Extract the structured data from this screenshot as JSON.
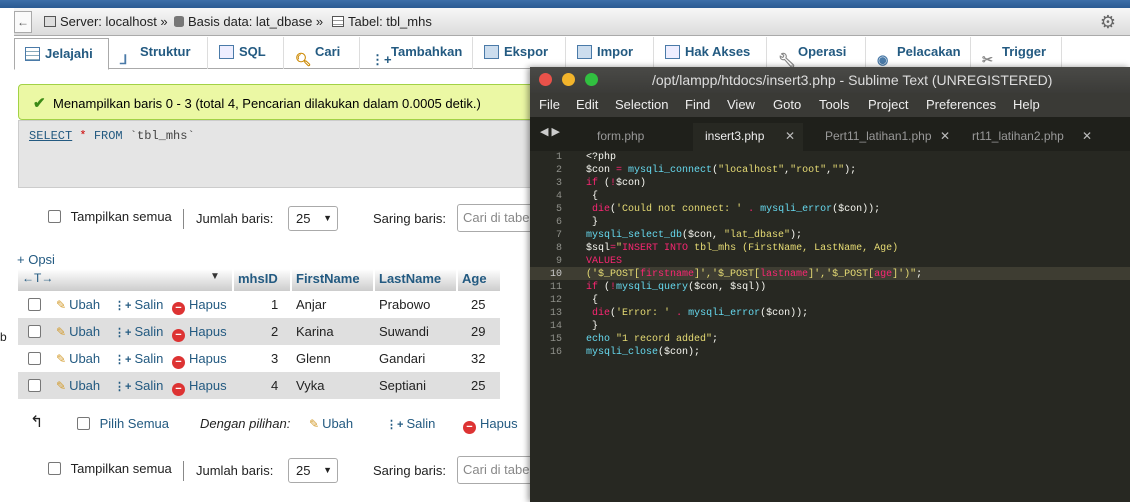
{
  "pma": {
    "breadcrumb": {
      "back": "←",
      "server": "Server: localhost »",
      "database": "Basis data: lat_dbase »",
      "table": "Tabel: tbl_mhs"
    },
    "tabs": [
      {
        "label": "Jelajahi",
        "icon": "browse-icon"
      },
      {
        "label": "Struktur",
        "icon": "structure-icon"
      },
      {
        "label": "SQL",
        "icon": "sql-icon"
      },
      {
        "label": "Cari",
        "icon": "search-icon"
      },
      {
        "label": "Tambahkan",
        "icon": "insert-icon"
      },
      {
        "label": "Ekspor",
        "icon": "export-icon"
      },
      {
        "label": "Impor",
        "icon": "import-icon"
      },
      {
        "label": "Hak Akses",
        "icon": "privileges-icon"
      },
      {
        "label": "Operasi",
        "icon": "operations-icon"
      },
      {
        "label": "Pelacakan",
        "icon": "tracking-icon"
      },
      {
        "label": "Trigger",
        "icon": "trigger-icon"
      }
    ],
    "success_message": "Menampilkan baris 0 - 3 (total 4, Pencarian dilakukan dalam 0.0005 detik.)",
    "sql": {
      "select": "SELECT",
      "star": "*",
      "from": "FROM",
      "table": "`tbl_mhs`"
    },
    "controls_top": {
      "show_all": "Tampilkan semua",
      "rows_label": "Jumlah baris:",
      "rows_value": "25",
      "filter_label": "Saring baris:",
      "filter_placeholder": "Cari di tabe"
    },
    "options_link": "+ Opsi",
    "columns": [
      "mhsID",
      "FirstName",
      "LastName",
      "Age"
    ],
    "actions": {
      "edit": "Ubah",
      "copy": "Salin",
      "delete": "Hapus"
    },
    "rows": [
      {
        "id": "1",
        "first": "Anjar",
        "last": "Prabowo",
        "age": "25"
      },
      {
        "id": "2",
        "first": "Karina",
        "last": "Suwandi",
        "age": "29"
      },
      {
        "id": "3",
        "first": "Glenn",
        "last": "Gandari",
        "age": "32"
      },
      {
        "id": "4",
        "first": "Vyka",
        "last": "Septiani",
        "age": "25"
      }
    ],
    "bulk": {
      "select_all": "Pilih Semua",
      "with_selected": "Dengan pilihan:",
      "edit": "Ubah",
      "copy": "Salin",
      "delete": "Hapus"
    },
    "controls_bottom": {
      "show_all": "Tampilkan semua",
      "rows_label": "Jumlah baris:",
      "rows_value": "25",
      "filter_label": "Saring baris:",
      "filter_placeholder": "Cari di tabe"
    },
    "side_letter": "b"
  },
  "sublime": {
    "title": "/opt/lampp/htdocs/insert3.php - Sublime Text (UNREGISTERED)",
    "menu": [
      "File",
      "Edit",
      "Selection",
      "Find",
      "View",
      "Goto",
      "Tools",
      "Project",
      "Preferences",
      "Help"
    ],
    "tabs": [
      "form.php",
      "insert3.php",
      "Pert11_latihan1.php",
      "rt11_latihan2.php"
    ],
    "active_tab": 1,
    "current_line": 10,
    "line_numbers": [
      "1",
      "2",
      "3",
      "4",
      "5",
      "6",
      "7",
      "8",
      "9",
      "10",
      "11",
      "12",
      "13",
      "14",
      "15",
      "16"
    ]
  },
  "colors": {
    "pma_link": "#235a81",
    "success_bg": "#ebf8a4",
    "sublime_bg": "#272822",
    "sublime_keyword": "#f92672",
    "sublime_function": "#66d9ef",
    "sublime_string": "#e6db74"
  }
}
